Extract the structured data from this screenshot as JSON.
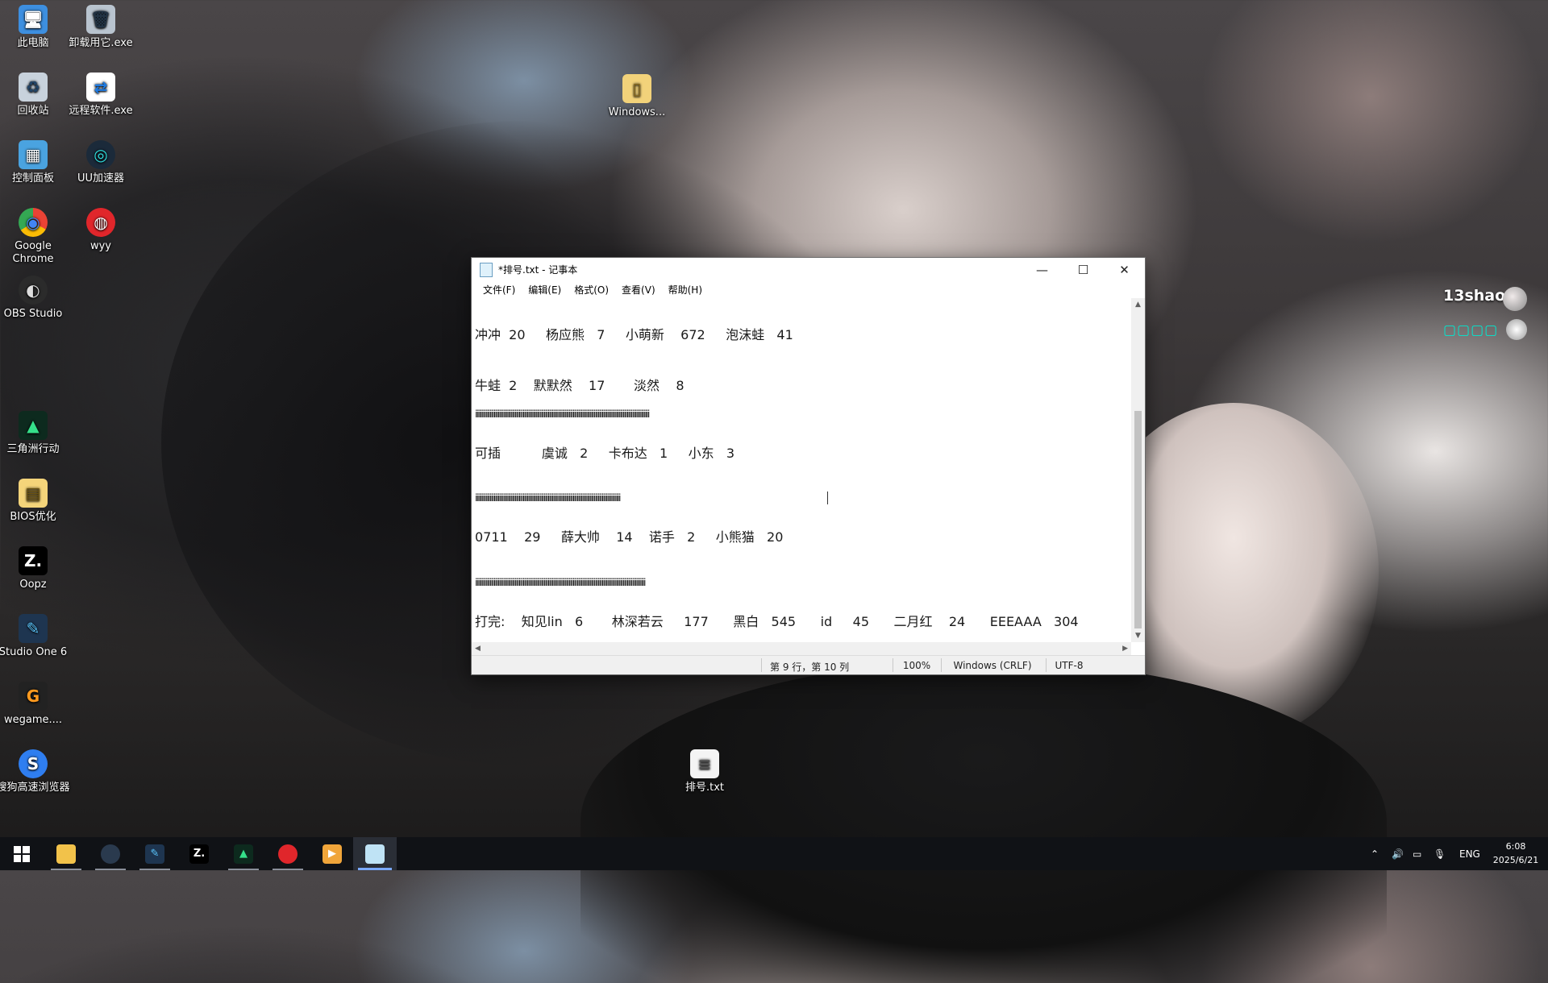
{
  "desktop": {
    "icons": [
      {
        "label": "此电脑",
        "glyph": "🖥"
      },
      {
        "label": "卸载用它.exe",
        "glyph": "🗑"
      },
      {
        "label": "回收站",
        "glyph": "♻"
      },
      {
        "label": "远程软件.exe",
        "glyph": "⇄"
      },
      {
        "label": "控制面板",
        "glyph": "▦"
      },
      {
        "label": "UU加速器",
        "glyph": "◎"
      },
      {
        "label": "Google Chrome",
        "glyph": "◉"
      },
      {
        "label": "wyy",
        "glyph": "◍"
      },
      {
        "label": "OBS Studio",
        "glyph": "◐"
      },
      {
        "label": "三角洲行动",
        "glyph": "▲"
      },
      {
        "label": "BIOS优化",
        "glyph": "▤"
      },
      {
        "label": "Oopz",
        "glyph": "Z."
      },
      {
        "label": "Studio One 6",
        "glyph": "✎"
      },
      {
        "label": "wegame....",
        "glyph": "G"
      },
      {
        "label": "搜狗高速浏览器",
        "glyph": "S"
      },
      {
        "label": "Windows...",
        "glyph": "▯"
      },
      {
        "label": "排号.txt",
        "glyph": "≡"
      }
    ]
  },
  "widget": {
    "username": "13shao",
    "subtitle": "▢▢▢▢"
  },
  "notepad": {
    "title": "*排号.txt - 记事本",
    "controls": {
      "minimize": "—",
      "maximize": "☐",
      "close": "✕"
    },
    "menu": [
      "文件(F)",
      "编辑(E)",
      "格式(O)",
      "查看(V)",
      "帮助(H)"
    ],
    "lines": [
      "冲冲  20     杨应熊   7     小萌新    672     泡沫蛙   41",
      "牛蛙  2    默默然    17       淡然    8",
      "iiiiiiiiiiiiiiiiiiiiiiiiiiiiiiiiiiiiiiiiiiiiiiiiiiiiiiiiiiiiiiiiiiiiiiiiiiiiiiiiiiiiiiiiiiiiiiiiiiiiiiiiiiiiiiiiiiiiiiiiiiiiiiiiiiii",
      "可插          虞诚   2     卡布达   1     小东   3",
      "iiiiiiiiiiiiiiiiiiiiiiiiiiiiiiiiiiiiiiiiiiiiiiiiiiiiiiiiiiiiiiiiiiiiiiiiiiiiiiiiiiiiiiiiiiiiiiiiiiiiiiiiiiiiii",
      "0711    29     薛大帅    14    诺手   2     小熊猫   20",
      "iiiiiiiiiiiiiiiiiiiiiiiiiiiiiiiiiiiiiiiiiiiiiiiiiiiiiiiiiiiiiiiiiiiiiiiiiiiiiiiiiiiiiiiiiiiiiiiiiiiiiiiiiiiiiiiiiiiiiiiiiiiiiiiii",
      "打完:    知见lin   6       林深若云     177      黑白   545      id     45      二月红    24      EEEAAA   304"
    ],
    "status": {
      "position": "第 9 行，第 10 列",
      "zoom": "100%",
      "line_ending": "Windows (CRLF)",
      "encoding": "UTF-8"
    }
  },
  "taskbar": {
    "apps": [
      "start",
      "file-explorer",
      "steam",
      "studio-one",
      "oopz",
      "delta-force",
      "wyy",
      "media-player",
      "notepad"
    ],
    "tray": {
      "language": "ENG",
      "time": "6:08",
      "date": "2025/6/21"
    }
  }
}
